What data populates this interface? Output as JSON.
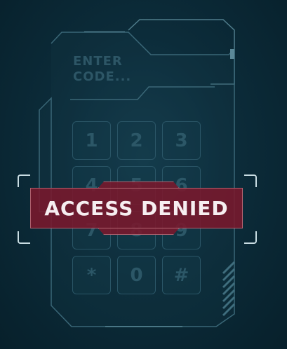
{
  "display": {
    "prompt": "ENTER\nCODE..."
  },
  "keypad": {
    "keys": [
      "1",
      "2",
      "3",
      "4",
      "5",
      "6",
      "7",
      "8",
      "9",
      "*",
      "0",
      "#"
    ]
  },
  "status": {
    "message": "ACCESS DENIED"
  },
  "colors": {
    "background": "#0c2c3a",
    "panel_outline": "#3a6777",
    "key_text": "#2c5767",
    "alert_fill": "#7a182c",
    "alert_border": "#b2626f",
    "alert_text": "#f6eef0"
  }
}
